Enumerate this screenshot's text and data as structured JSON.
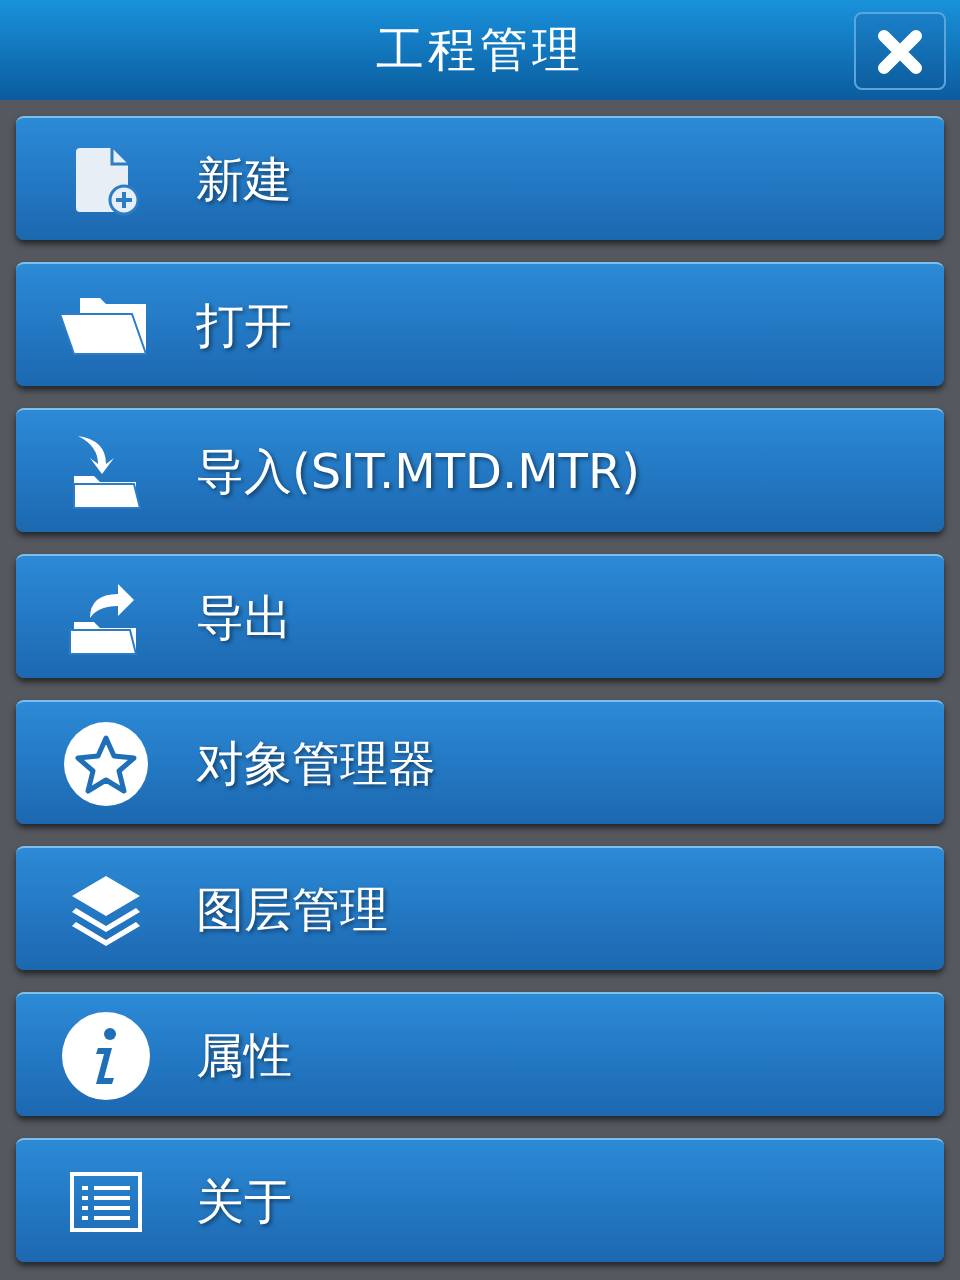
{
  "header": {
    "title": "工程管理"
  },
  "menu": [
    {
      "label": "新建",
      "kind": "new"
    },
    {
      "label": "打开",
      "kind": "open"
    },
    {
      "label": "导入(SIT.MTD.MTR)",
      "kind": "import"
    },
    {
      "label": "导出",
      "kind": "export"
    },
    {
      "label": "对象管理器",
      "kind": "objects"
    },
    {
      "label": "图层管理",
      "kind": "layers"
    },
    {
      "label": "属性",
      "kind": "info"
    },
    {
      "label": "关于",
      "kind": "about"
    }
  ]
}
